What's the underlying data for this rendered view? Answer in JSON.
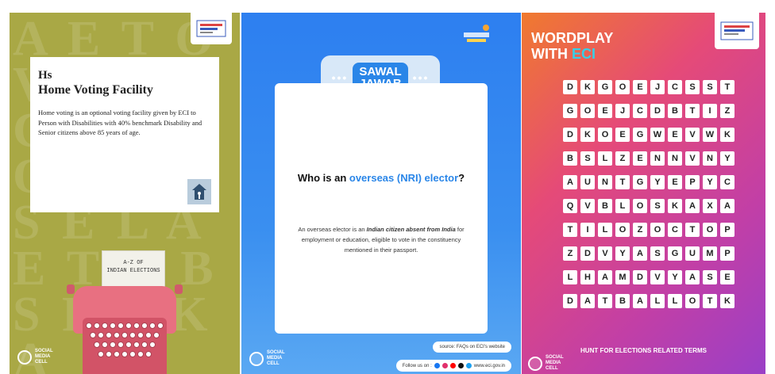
{
  "panel1": {
    "card": {
      "heading_line1": "Hs",
      "heading_line2": "Home Voting Facility",
      "body": "Home voting is an optional voting facility given by ECI to Person with Disabilities with 40% benchmark Disability and Senior citizens above 85 years of age."
    },
    "typewriter_paper": {
      "line1": "A-Z OF",
      "line2": "INDIAN ELECTIONS"
    },
    "cell_logo": {
      "line1": "SOCIAL",
      "line2": "MEDIA",
      "line3": "CELL"
    }
  },
  "panel2": {
    "badge": {
      "line1": "SAWAL",
      "line2": "JAWAB"
    },
    "question": {
      "prefix": "Who is an ",
      "highlight": "overseas (NRI) elector",
      "suffix": "?"
    },
    "answer": {
      "part1": "An overseas elector is an ",
      "bold": "Indian citizen absent from India",
      "part2": " for employment or education, eligible to vote in the constituency mentioned in their passport."
    },
    "source": "source: FAQs on ECI's website",
    "follow_label": "Follow us on :",
    "website": "www.eci.gov.in",
    "cell_logo": {
      "line1": "SOCIAL",
      "line2": "MEDIA",
      "line3": "CELL"
    },
    "social_colors": [
      "#1877f2",
      "#e1306c",
      "#ff0000",
      "#111111",
      "#1da1f2"
    ]
  },
  "panel3": {
    "title_line1": "WORDPLAY",
    "title_line2_prefix": "WITH ",
    "title_line2_accent": "ECI",
    "grid": [
      [
        "D",
        "K",
        "G",
        "O",
        "E",
        "J",
        "C",
        "S",
        "S",
        "T"
      ],
      [
        "G",
        "O",
        "E",
        "J",
        "C",
        "D",
        "B",
        "T",
        "I",
        "Z"
      ],
      [
        "D",
        "K",
        "O",
        "E",
        "G",
        "W",
        "E",
        "V",
        "W",
        "K"
      ],
      [
        "B",
        "S",
        "L",
        "Z",
        "E",
        "N",
        "N",
        "V",
        "N",
        "Y"
      ],
      [
        "A",
        "U",
        "N",
        "T",
        "G",
        "Y",
        "E",
        "P",
        "Y",
        "C"
      ],
      [
        "Q",
        "V",
        "B",
        "L",
        "O",
        "S",
        "K",
        "A",
        "X",
        "A"
      ],
      [
        "T",
        "I",
        "L",
        "O",
        "Z",
        "O",
        "C",
        "T",
        "O",
        "P"
      ],
      [
        "Z",
        "D",
        "V",
        "Y",
        "A",
        "S",
        "G",
        "U",
        "M",
        "P"
      ],
      [
        "L",
        "H",
        "A",
        "M",
        "D",
        "V",
        "Y",
        "A",
        "S",
        "E"
      ],
      [
        "D",
        "A",
        "T",
        "B",
        "A",
        "L",
        "L",
        "O",
        "T",
        "K"
      ]
    ],
    "hunt": "HUNT FOR ELECTIONS RELATED TERMS",
    "cell_logo": {
      "line1": "SOCIAL",
      "line2": "MEDIA",
      "line3": "CELL"
    }
  },
  "colors": {
    "panel1_bg": "#a9a845",
    "panel2_bg": "#2d7ff0",
    "panel3_accent": "#36d0e8",
    "typewriter": "#e87081"
  }
}
